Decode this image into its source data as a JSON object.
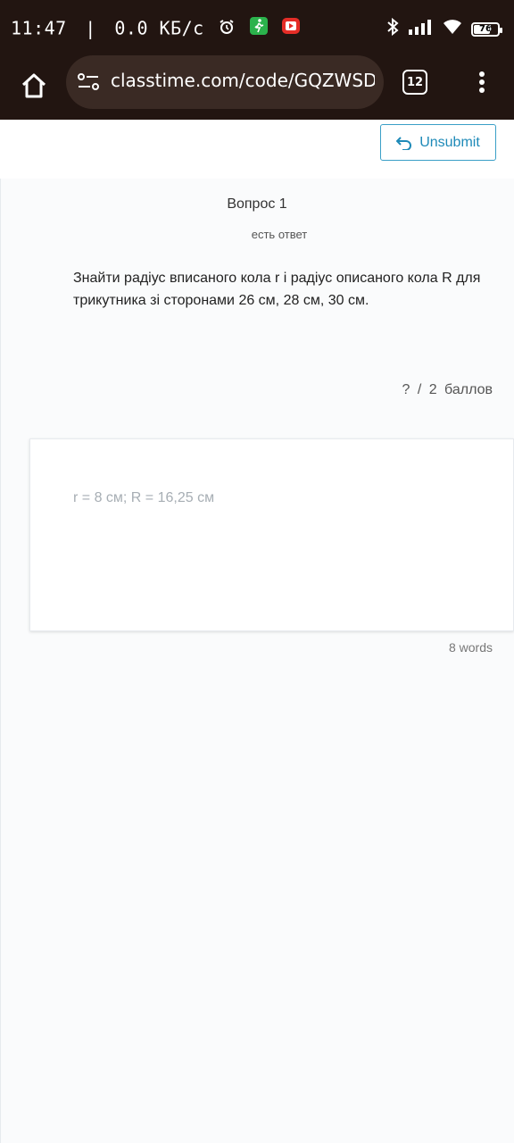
{
  "status_bar": {
    "time": "11:47",
    "separator": "|",
    "speed": "0.0 КБ/с",
    "icons": [
      "alarm-icon",
      "walking-icon",
      "youtube-icon"
    ],
    "right_icons": [
      "bluetooth-icon",
      "signal-icon",
      "wifi-icon",
      "battery-icon"
    ],
    "battery": "76"
  },
  "browser": {
    "url": "classtime.com/code/GQZWSD",
    "tab_count": "12"
  },
  "toolbar": {
    "unsubmit_label": "Unsubmit"
  },
  "question": {
    "title": "Вопрос 1",
    "status": "есть ответ",
    "text": "Знайти радіус вписаного кола r і радіус описаного кола R для трикутника зі сторонами 26 см, 28 см, 30 см.",
    "score": "? / 2 баллов"
  },
  "answer": {
    "text": "r = 8 см; R = 16,25 см",
    "word_count": "8 words"
  },
  "colors": {
    "system_bar": "#221511",
    "accent": "#1e8ab8",
    "answer_text": "#a7aeb4"
  }
}
